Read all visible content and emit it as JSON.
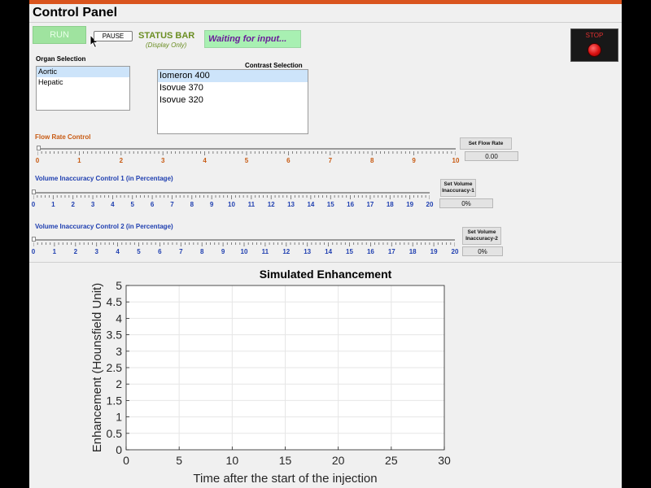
{
  "title": "Control Panel",
  "buttons": {
    "run": "RUN",
    "pause": "PAUSE"
  },
  "status": {
    "label": "STATUS BAR",
    "sublabel": "(Display Only)",
    "text": "Waiting for input..."
  },
  "stop": {
    "label": "STOP"
  },
  "organ": {
    "label": "Organ Selection",
    "items": [
      "Aortic",
      "Hepatic"
    ],
    "selected": 0
  },
  "contrast": {
    "label": "Contrast Selection",
    "items": [
      "Iomeron 400",
      "Isovue 370",
      "Isovue 320"
    ],
    "selected": 0
  },
  "flow": {
    "label": "Flow Rate Control",
    "set_label": "Set Flow Rate",
    "value_text": "0.00",
    "tick_labels": [
      "0",
      "1",
      "2",
      "3",
      "4",
      "5",
      "6",
      "7",
      "8",
      "9",
      "10"
    ]
  },
  "vol1": {
    "label": "Volume Inaccuracy Control 1 (in Percentage)",
    "set_label": "Set Volume Inaccuracy-1",
    "value_text": "0%",
    "tick_labels": [
      "0",
      "1",
      "2",
      "3",
      "4",
      "5",
      "6",
      "7",
      "8",
      "9",
      "10",
      "11",
      "12",
      "13",
      "14",
      "15",
      "16",
      "17",
      "18",
      "19",
      "20"
    ]
  },
  "vol2": {
    "label": "Volume Inaccuracy Control 2 (in Percentage)",
    "set_label": "Set Volume Inaccuracy-2",
    "value_text": "0%",
    "tick_labels": [
      "0",
      "1",
      "2",
      "3",
      "4",
      "5",
      "6",
      "7",
      "8",
      "9",
      "10",
      "11",
      "12",
      "13",
      "14",
      "15",
      "16",
      "17",
      "18",
      "19",
      "20"
    ]
  },
  "colors": {
    "accent_bar": "#d9541e",
    "run_button": "#9fe39f",
    "status_box": "#a8f0b2",
    "selection": "#cde4fa"
  },
  "chart_data": {
    "type": "line",
    "title": "Simulated Enhancement",
    "xlabel": "Time after the start of the injection",
    "ylabel": "Enhancement (Hounsfield Unit)",
    "xlim": [
      0,
      30
    ],
    "ylim": [
      0,
      5
    ],
    "x_ticks": [
      "0",
      "5",
      "10",
      "15",
      "20",
      "25",
      "30"
    ],
    "y_ticks": [
      "0",
      "0.5",
      "1",
      "1.5",
      "2",
      "2.5",
      "3",
      "3.5",
      "4",
      "4.5",
      "5"
    ],
    "grid": true,
    "series": []
  }
}
